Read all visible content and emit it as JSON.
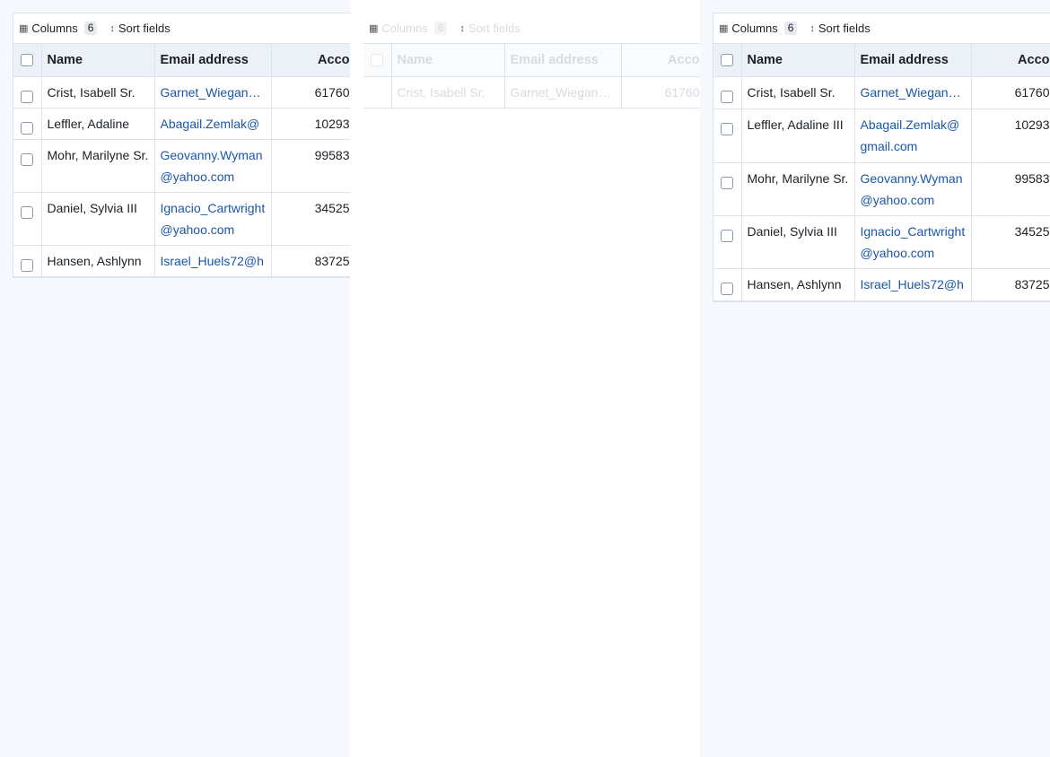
{
  "toolbar": {
    "columns_label": "Columns",
    "columns_count": "6",
    "sort_label": "Sort fields"
  },
  "headers": {
    "name": "Name",
    "email": "Email address",
    "account": "Acco"
  },
  "rows": [
    {
      "name": "Crist, Isabell Sr.",
      "email": "Garnet_Wiegand…",
      "account": "61760"
    },
    {
      "name": "Leffler, Adaline III",
      "email": "Abagail.Zemlak@gmail.com",
      "account": "10293"
    },
    {
      "name": "Mohr, Marilyne Sr.",
      "email": "Geovanny.Wyman@yahoo.com",
      "account": "99583"
    },
    {
      "name": "Daniel, Sylvia III",
      "email": "Ignacio_Cartwright@yahoo.com",
      "account": "34525"
    },
    {
      "name": "Hansen, Ashlynn",
      "email": "Israel_Huels72@h",
      "account": "83725"
    }
  ],
  "left_rows": {
    "leffler_name": "Leffler, Adaline",
    "leffler_email": "Abagail.Zemlak@",
    "mohr_name": "Mohr, Marilyne Sr.",
    "mohr_email": "Geovanny.Wyman@yahoo.com",
    "daniel_email": "Ignacio_Cartwright@yahoo.com"
  },
  "right_rows": {
    "leffler_name": "Leffler, Adaline III",
    "leffler_email": "Abagail.Zemlak@gmail.com"
  }
}
